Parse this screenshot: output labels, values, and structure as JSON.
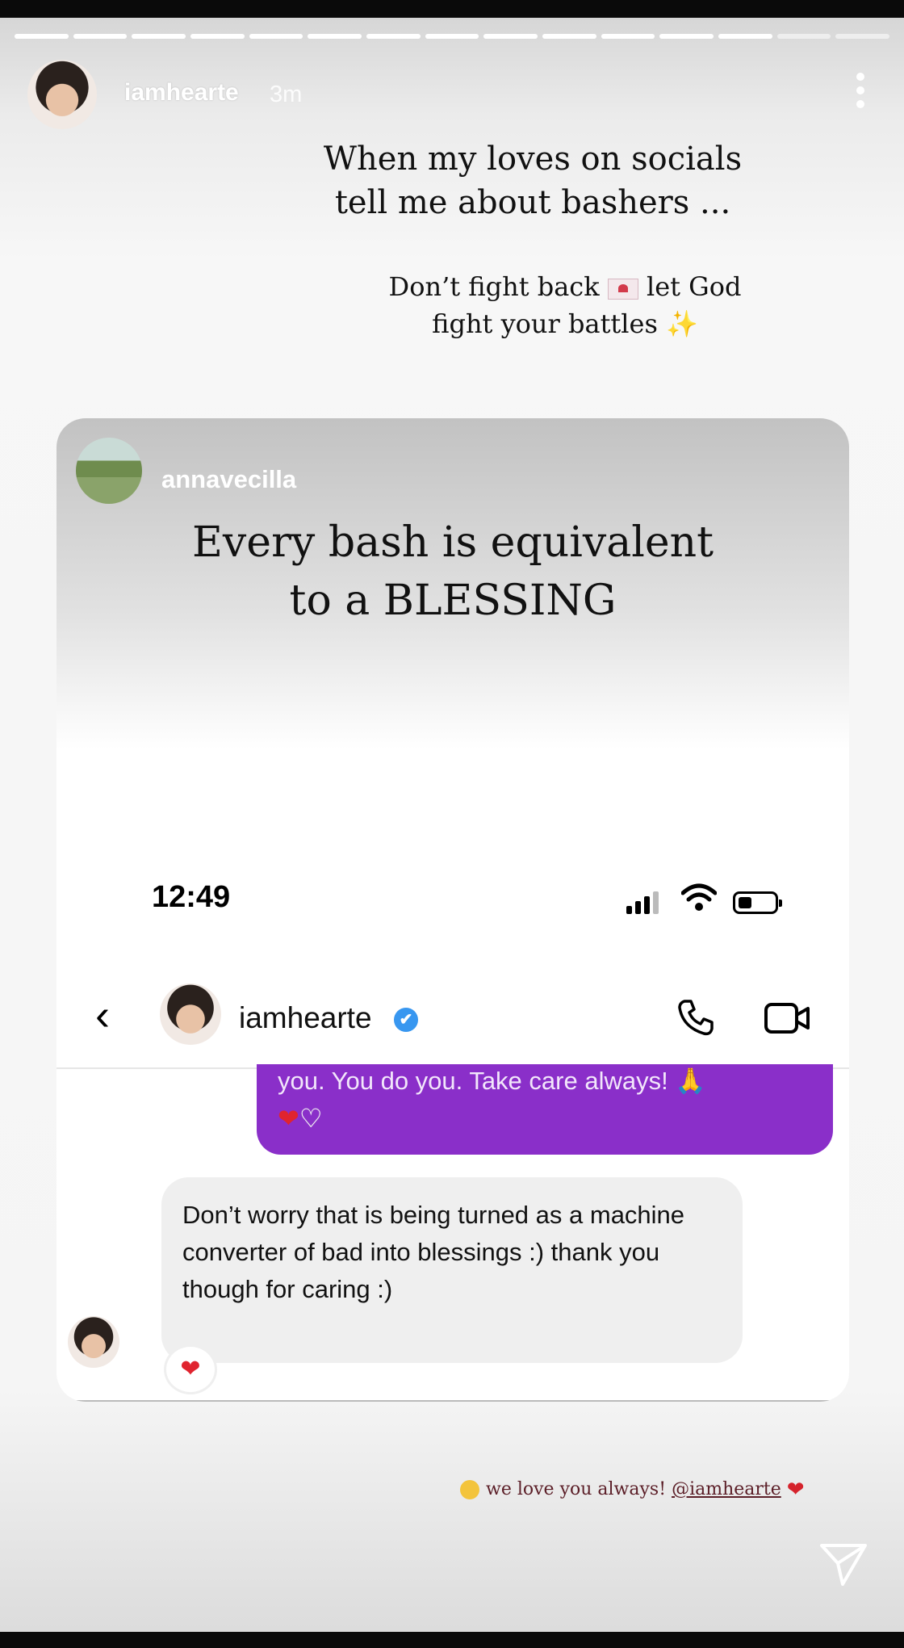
{
  "story": {
    "progress_segments": 15,
    "progress_filled": 13,
    "username": "iamhearte",
    "time_ago": "3m",
    "caption_line1": "When my loves on socials",
    "caption_line2": "tell me about bashers ...",
    "caption2_part1": "Don’t fight back",
    "caption2_part2": "let God",
    "caption2_line2": "fight your battles",
    "sparkle": "✨",
    "mention_text": "we love you always!",
    "mention_tag": "@iamhearte"
  },
  "shared_post": {
    "username": "annavecilla",
    "quote_line1": "Every bash is equivalent",
    "quote_line2": "to a BLESSING"
  },
  "dm": {
    "status_time": "12:49",
    "contact_name": "iamhearte",
    "verified_glyph": "✔",
    "sent_message": "you. You do you. Take care always!",
    "sent_emoji_pray": "🙏",
    "heart_red": "❤",
    "heart_white": "♡",
    "received_message": "Don’t worry that is being turned as a machine converter of bad into blessings :) thank you though for caring :)",
    "reaction": "❤"
  },
  "colors": {
    "accent_purple": "#8a2fc9",
    "verified_blue": "#3897f0",
    "heart_red": "#e0242f"
  },
  "icons": [
    "more-icon",
    "back-icon",
    "verified-icon",
    "phone-icon",
    "video-icon",
    "send-icon",
    "signal-icon",
    "wifi-icon",
    "battery-icon"
  ]
}
